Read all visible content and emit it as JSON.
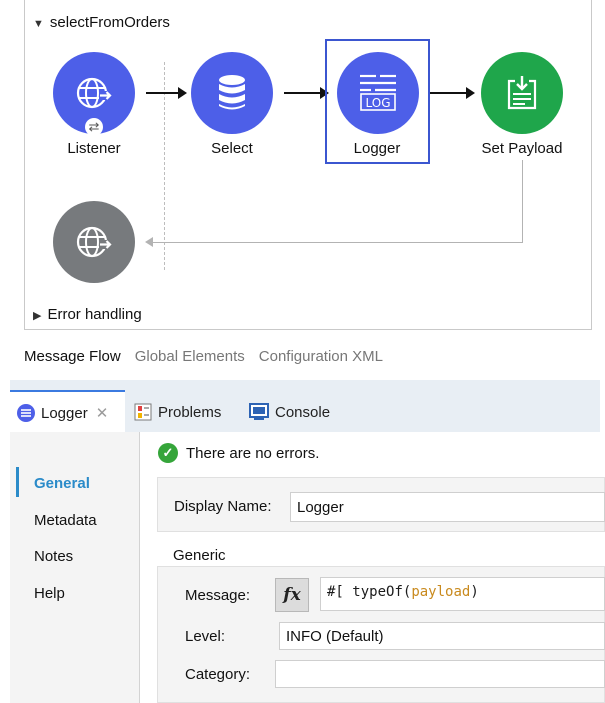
{
  "flow": {
    "name": "selectFromOrders",
    "nodes": {
      "listener": "Listener",
      "select": "Select",
      "logger": "Logger",
      "set_payload": "Set Payload"
    },
    "logger_icon_text": "LOG",
    "error_handling": "Error handling"
  },
  "view_tabs": [
    "Message Flow",
    "Global Elements",
    "Configuration XML"
  ],
  "panel": {
    "tabs": {
      "logger": "Logger",
      "problems": "Problems",
      "console": "Console"
    },
    "status": "There are no errors.",
    "nav": [
      "General",
      "Metadata",
      "Notes",
      "Help"
    ],
    "display_name_label": "Display Name:",
    "display_name_value": "Logger",
    "generic_label": "Generic",
    "message_label": "Message:",
    "message_expr": {
      "prefix": "#[ ",
      "fn": "typeOf(",
      "arg": "payload",
      "suffix": ")"
    },
    "fx_label": "fx",
    "level_label": "Level:",
    "level_value": "INFO (Default)",
    "category_label": "Category:",
    "category_value": ""
  },
  "colors": {
    "node_blue": "#4d5fe8",
    "node_green": "#1fa64b",
    "node_grey": "#777a7d",
    "selection": "#3b56d0",
    "accent": "#2b8bc9",
    "ok": "#35a53a"
  },
  "icons": [
    "globe-icon",
    "database-icon",
    "log-icon",
    "set-payload-icon",
    "close-icon",
    "problems-icon",
    "console-icon",
    "check-icon"
  ]
}
